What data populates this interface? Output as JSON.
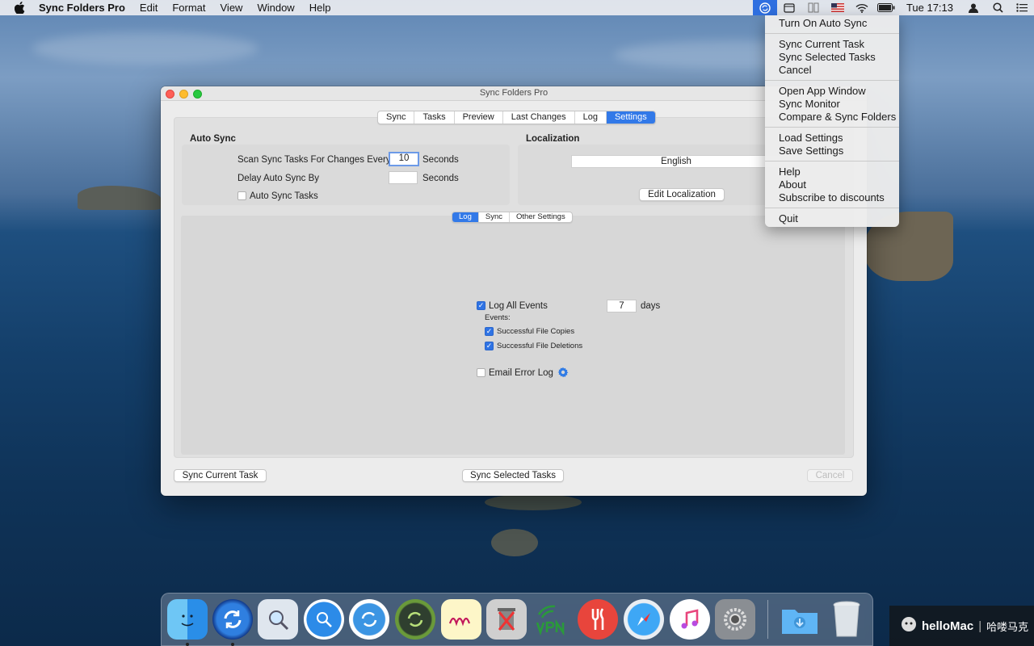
{
  "menubar": {
    "app_name": "Sync Folders Pro",
    "menus": [
      "Edit",
      "Format",
      "View",
      "Window",
      "Help"
    ],
    "clock": "Tue 17:13",
    "status_icons": [
      "sync-folders-status-icon",
      "calendar-icon",
      "columns-icon",
      "us-flag-icon",
      "wifi-icon",
      "battery-icon",
      "user-icon",
      "spotlight-icon",
      "list-icon"
    ]
  },
  "dropdown": {
    "groups": [
      [
        "Turn On Auto Sync"
      ],
      [
        "Sync Current Task",
        "Sync Selected Tasks",
        "Cancel"
      ],
      [
        "Open App Window",
        "Sync Monitor",
        "Compare & Sync Folders"
      ],
      [
        "Load Settings",
        "Save Settings"
      ],
      [
        "Help",
        "About",
        "Subscribe to discounts"
      ],
      [
        "Quit"
      ]
    ]
  },
  "window": {
    "title": "Sync Folders Pro",
    "tabs": [
      "Sync",
      "Tasks",
      "Preview",
      "Last Changes",
      "Log",
      "Settings"
    ],
    "active_tab": "Settings",
    "auto_sync": {
      "title": "Auto Sync",
      "scan_label": "Scan Sync Tasks For Changes Every",
      "scan_value": "10",
      "scan_unit": "Seconds",
      "delay_label": "Delay Auto Sync By",
      "delay_value": "",
      "delay_unit": "Seconds",
      "auto_sync_tasks_label": "Auto Sync Tasks",
      "auto_sync_tasks_checked": false
    },
    "localization": {
      "title": "Localization",
      "language": "English",
      "edit_button": "Edit Localization"
    },
    "sub_tabs": [
      "Log",
      "Sync",
      "Other Settings"
    ],
    "active_sub_tab": "Log",
    "log": {
      "log_all_events_label": "Log All Events",
      "log_all_events_checked": true,
      "days_value": "7",
      "days_label": "days",
      "events_label": "Events:",
      "successful_copies_label": "Successful File Copies",
      "successful_copies_checked": true,
      "successful_deletions_label": "Successful File Deletions",
      "successful_deletions_checked": true,
      "email_error_log_label": "Email Error Log",
      "email_error_log_checked": false
    },
    "buttons": {
      "sync_current": "Sync Current Task",
      "sync_selected": "Sync Selected Tasks",
      "cancel": "Cancel"
    }
  },
  "dock": {
    "apps": [
      "finder-icon",
      "sync-folders-pro-icon",
      "preview-icon",
      "file-magnifier-icon",
      "sync-blue-icon",
      "sync-dark-icon",
      "text-edit-icon",
      "trash-tool-icon",
      "vpn-icon",
      "food-app-icon",
      "safari-icon",
      "itunes-icon",
      "system-preferences-icon",
      "downloads-folder-icon",
      "trash-icon"
    ]
  },
  "watermark": {
    "brand": "helloMac",
    "cn": "哈喽马克"
  }
}
